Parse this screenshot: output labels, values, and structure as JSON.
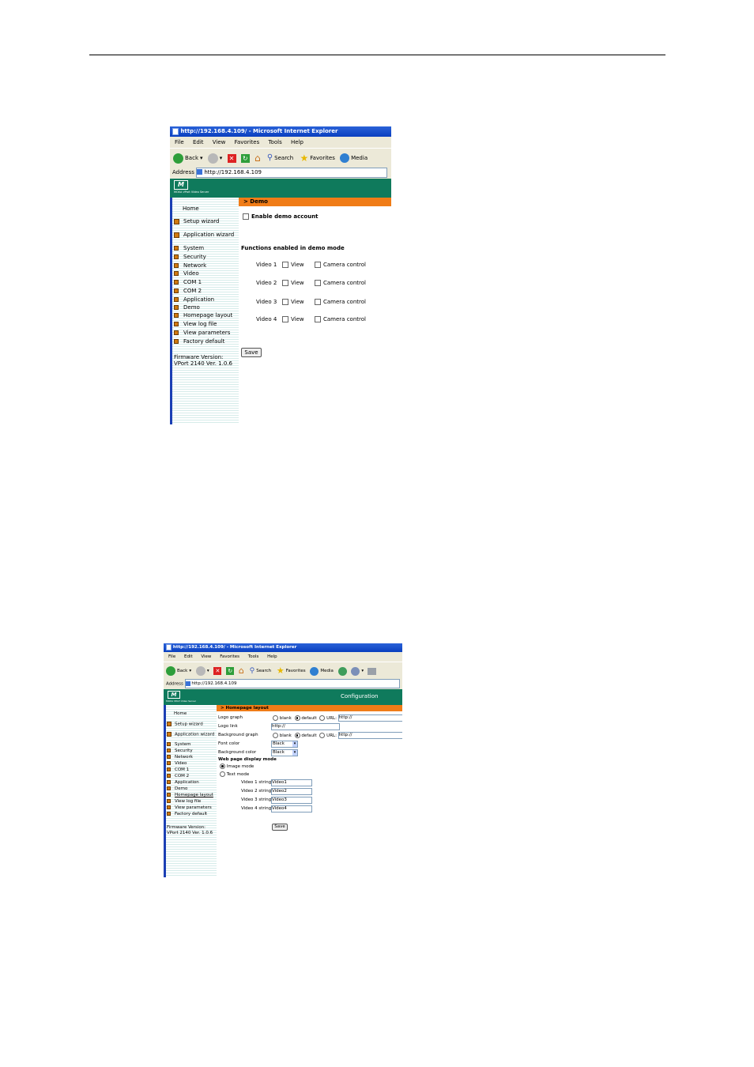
{
  "window1": {
    "title": "http://192.168.4.109/ - Microsoft Internet Explorer",
    "menu": [
      "File",
      "Edit",
      "View",
      "Favorites",
      "Tools",
      "Help"
    ],
    "toolbar": {
      "back": "Back",
      "search": "Search",
      "favorites": "Favorites",
      "media": "Media"
    },
    "address_label": "Address",
    "address_value": "http://192.168.4.109",
    "logo_sub": "MOXA VPort Video Server",
    "sidebar": {
      "home": "Home",
      "setup_wizard": "Setup wizard",
      "application_wizard": "Application wizard",
      "items": [
        "System",
        "Security",
        "Network",
        "Video",
        "COM 1",
        "COM 2",
        "Application",
        "Demo",
        "Homepage layout",
        "View log file",
        "View parameters",
        "Factory default"
      ],
      "firmware_label": "Firmware Version:",
      "firmware_value": "VPort 2140 Ver. 1.0.6"
    },
    "section_title": "> Demo",
    "enable_demo": "Enable demo account",
    "functions_heading": "Functions enabled in demo mode",
    "videos": [
      {
        "label": "Video 1",
        "view": "View",
        "camera": "Camera control"
      },
      {
        "label": "Video 2",
        "view": "View",
        "camera": "Camera control"
      },
      {
        "label": "Video 3",
        "view": "View",
        "camera": "Camera control"
      },
      {
        "label": "Video 4",
        "view": "View",
        "camera": "Camera control"
      }
    ],
    "save": "Save"
  },
  "window2": {
    "title": "http://192.168.4.109/ - Microsoft Internet Explorer",
    "menu": [
      "File",
      "Edit",
      "View",
      "Favorites",
      "Tools",
      "Help"
    ],
    "toolbar": {
      "back": "Back",
      "search": "Search",
      "favorites": "Favorites",
      "media": "Media"
    },
    "address_label": "Address",
    "address_value": "http://192.168.4.109",
    "logo_sub": "MOXA VPort Video Server",
    "header_title": "Configuration",
    "sidebar": {
      "home": "Home",
      "setup_wizard": "Setup wizard",
      "application_wizard": "Application wizard",
      "items": [
        "System",
        "Security",
        "Network",
        "Video",
        "COM 1",
        "COM 2",
        "Application",
        "Demo",
        "Homepage layout",
        "View log file",
        "View parameters",
        "Factory default"
      ],
      "firmware_label": "Firmware Version:",
      "firmware_value": "VPort 2140 Ver. 1.0.6"
    },
    "section_title": "> Homepage layout",
    "logo_graph": {
      "label": "Logo graph",
      "blank": "blank",
      "default": "default",
      "url": "URL:",
      "url_value": "http://"
    },
    "logo_link": {
      "label": "Logo link",
      "value": "http://"
    },
    "bg_graph": {
      "label": "Background graph",
      "blank": "blank",
      "default": "default",
      "url": "URL:",
      "url_value": "http://"
    },
    "font_color": {
      "label": "Font color",
      "value": "Black"
    },
    "bg_color": {
      "label": "Background color",
      "value": "Black"
    },
    "display_mode": {
      "heading": "Web page display mode",
      "image": "Image mode",
      "text": "Text mode"
    },
    "strings": [
      {
        "label": "Video 1 string",
        "value": "Video1"
      },
      {
        "label": "Video 2 string",
        "value": "Video2"
      },
      {
        "label": "Video 3 string",
        "value": "Video3"
      },
      {
        "label": "Video 4 string",
        "value": "Video4"
      }
    ],
    "save": "Save"
  },
  "colors": {
    "header": "#0f7a5c",
    "section": "#f07c17",
    "titlebar": "#0a3fbf",
    "sidebar_border": "#1b3fb4"
  }
}
